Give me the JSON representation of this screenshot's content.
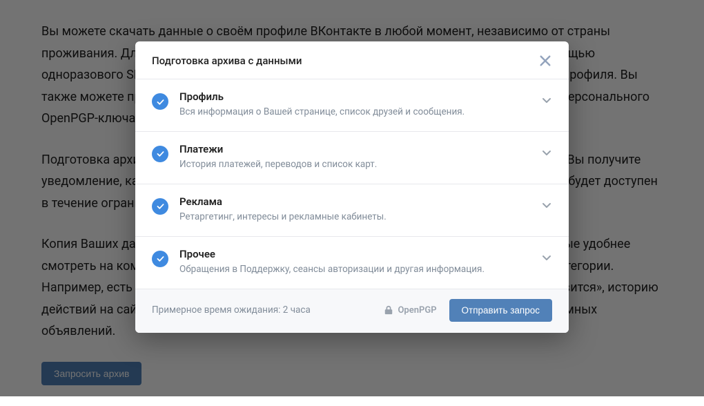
{
  "background": {
    "paragraph1": "Вы можете скачать данные о своём профиле ВКонтакте в любой момент, независимо от страны проживания. Для этого необходимо запросить специальный архив и подтвердить с помощью одноразового SMS-кода, что это делаете именно Вы, а не кто-то посторонний из другого профиля. Вы также можете предварительно выбрать типы данных и зашифровать архив с помощью персонального OpenPGP-ключа.",
    "paragraph2": "Подготовка архива займёт некоторое время — от нескольких минут до нескольких дней. Вы получите уведомление, как только архив будет сформирован. Для безопасности Ваших данных он будет доступен в течение ограниченного периода времени.",
    "paragraph3": "Копия Ваших данных будет упакована внутрь ZIP-архива в формате HTML. Поэтому данные удобнее смотреть на компьютере в одном из современных браузеров. Они разбиты на разные категории. Например, есть возможность посмотреть список публикаций, получивших отметку «Нравится», историю действий на сайте, а также интересы, которые система определяет при таргетинге рекламных объявлений.",
    "button": "Запросить архив"
  },
  "modal": {
    "title": "Подготовка архива с данными",
    "categories": [
      {
        "title": "Профиль",
        "desc": "Вся информация о Вашей странице, список друзей и сообщения."
      },
      {
        "title": "Платежи",
        "desc": "История платежей, переводов и список карт."
      },
      {
        "title": "Реклама",
        "desc": "Ретаргетинг, интересы и рекламные кабинеты."
      },
      {
        "title": "Прочее",
        "desc": "Обращения в Поддержку, сеансы авторизации и другая информация."
      }
    ],
    "wait_label": "Примерное время ожидания:",
    "wait_value": "2 часа",
    "openpgp": "OpenPGP",
    "submit": "Отправить запрос"
  }
}
